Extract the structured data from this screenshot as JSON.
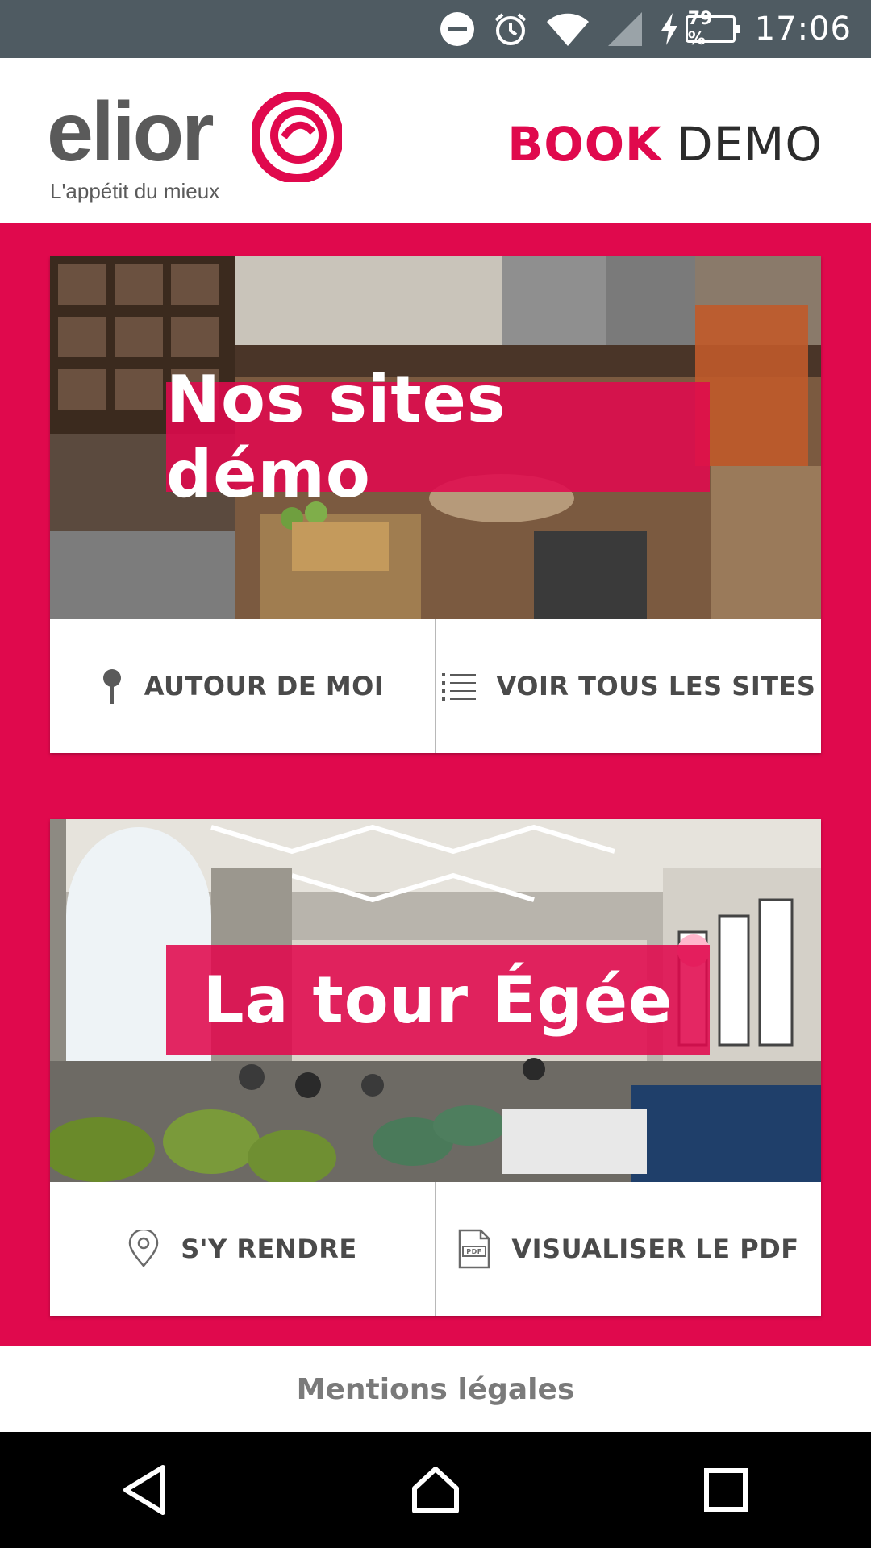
{
  "status_bar": {
    "battery": "79 %",
    "time": "17:06",
    "icons": [
      "do-not-disturb-icon",
      "alarm-icon",
      "wifi-icon",
      "cell-signal-icon",
      "charging-icon",
      "battery-icon"
    ]
  },
  "header": {
    "logo_word": "elior",
    "logo_tagline": "L'appétit du mieux",
    "book_label": "BOOK",
    "demo_label": "DEMO"
  },
  "cards": [
    {
      "title": "Nos sites démo",
      "actions": [
        {
          "label": "AUTOUR DE MOI",
          "icon": "map-pin-icon"
        },
        {
          "label": "VOIR TOUS LES SITES",
          "icon": "list-icon"
        }
      ]
    },
    {
      "title": "La tour Égée",
      "actions": [
        {
          "label": "S'Y RENDRE",
          "icon": "location-outline-icon"
        },
        {
          "label": "VISUALISER LE PDF",
          "icon": "pdf-file-icon"
        }
      ]
    }
  ],
  "footer": {
    "legal_link": "Mentions légales"
  },
  "colors": {
    "brand_pink": "#e0094d",
    "status_bar": "#4f5b62",
    "text_dark": "#4a4a4a"
  },
  "nav_bar": {
    "buttons": [
      "back-icon",
      "home-icon",
      "recents-icon"
    ]
  }
}
